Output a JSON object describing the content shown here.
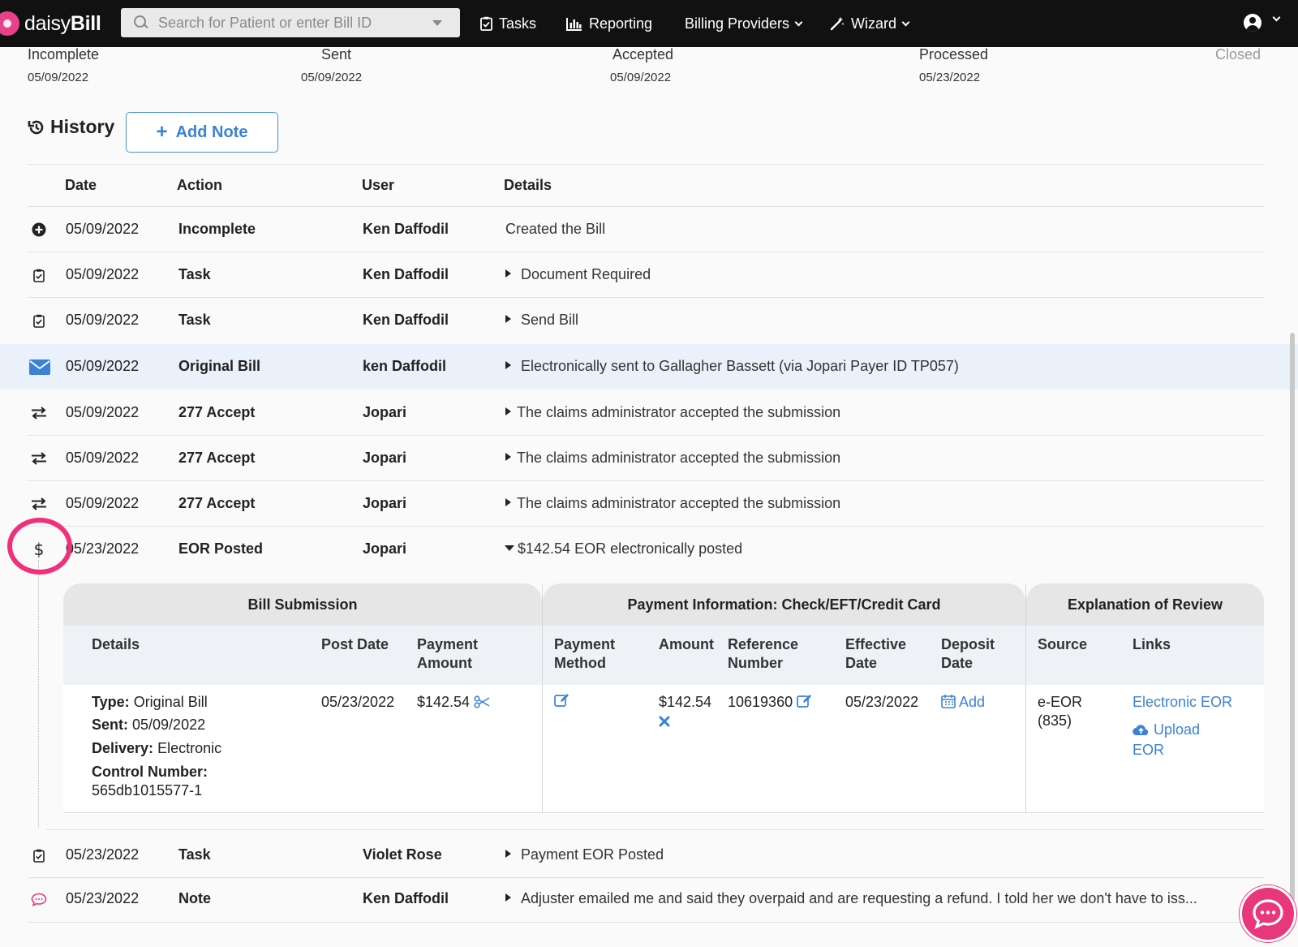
{
  "nav": {
    "logo_light": "daisy",
    "logo_bold": "Bill",
    "search_placeholder": "Search for Patient or enter Bill ID",
    "tasks": "Tasks",
    "reporting": "Reporting",
    "billing_providers": "Billing Providers",
    "wizard": "Wizard"
  },
  "statuses": [
    {
      "label": "Incomplete",
      "date": "05/09/2022"
    },
    {
      "label": "Sent",
      "date": "05/09/2022"
    },
    {
      "label": "Accepted",
      "date": "05/09/2022"
    },
    {
      "label": "Processed",
      "date": "05/23/2022"
    },
    {
      "label": "Closed",
      "date": ""
    }
  ],
  "history": {
    "title": "History",
    "add_note": "Add Note",
    "headers": {
      "date": "Date",
      "action": "Action",
      "user": "User",
      "details": "Details"
    },
    "rows": [
      {
        "icon": "plus-circle-icon",
        "date": "05/09/2022",
        "action": "Incomplete",
        "user": "Ken Daffodil",
        "details": "Created the Bill"
      },
      {
        "icon": "clipboard-check-icon",
        "date": "05/09/2022",
        "action": "Task",
        "user": "Ken Daffodil",
        "details": "Document Required"
      },
      {
        "icon": "clipboard-check-icon",
        "date": "05/09/2022",
        "action": "Task",
        "user": "Ken Daffodil",
        "details": "Send Bill"
      },
      {
        "icon": "envelope-icon",
        "date": "05/09/2022",
        "action": "Original Bill",
        "user": "ken Daffodil",
        "details": "Electronically sent to Gallagher Bassett (via Jopari Payer ID TP057)"
      },
      {
        "icon": "exchange-icon",
        "date": "05/09/2022",
        "action": "277 Accept",
        "user": "Jopari",
        "details": "The claims administrator accepted the submission"
      },
      {
        "icon": "exchange-icon",
        "date": "05/09/2022",
        "action": "277 Accept",
        "user": "Jopari",
        "details": "The claims administrator accepted the submission"
      },
      {
        "icon": "exchange-icon",
        "date": "05/09/2022",
        "action": "277 Accept",
        "user": "Jopari",
        "details": "The claims administrator accepted the submission"
      },
      {
        "icon": "dollar-icon",
        "date": "05/23/2022",
        "action": "EOR Posted",
        "user": "Jopari",
        "details": "$142.54 EOR electronically posted"
      },
      {
        "icon": "clipboard-check-icon",
        "date": "05/23/2022",
        "action": "Task",
        "user": "Violet Rose",
        "details": "Payment EOR Posted"
      },
      {
        "icon": "comment-icon",
        "date": "05/23/2022",
        "action": "Note",
        "user": "Ken Daffodil",
        "details": "Adjuster emailed me and said they overpaid and are requesting a refund. I told her we don't have to iss..."
      }
    ]
  },
  "eor": {
    "groups": {
      "bill_submission": "Bill Submission",
      "payment_info": "Payment Information: Check/EFT/Credit Card",
      "explanation": "Explanation of Review"
    },
    "subheaders": {
      "details": "Details",
      "post_date": "Post Date",
      "payment_amount_1": "Payment",
      "payment_amount_2": "Amount",
      "payment_method_1": "Payment",
      "payment_method_2": "Method",
      "amount": "Amount",
      "reference_number_1": "Reference",
      "reference_number_2": "Number",
      "effective_date_1": "Effective",
      "effective_date_2": "Date",
      "deposit_date_1": "Deposit",
      "deposit_date_2": "Date",
      "source": "Source",
      "links": "Links"
    },
    "body": {
      "type_label": "Type:",
      "type_value": "Original Bill",
      "sent_label": "Sent:",
      "sent_value": "05/09/2022",
      "delivery_label": "Delivery:",
      "delivery_value": "Electronic",
      "control_label": "Control Number:",
      "control_value": "565db1015577-1",
      "post_date": "05/23/2022",
      "payment_amount": "$142.54",
      "amount": "$142.54",
      "reference_number": "10619360",
      "effective_date": "05/23/2022",
      "deposit_add": "Add",
      "source_1": "e-EOR",
      "source_2": "(835)",
      "link_electronic": "Electronic EOR",
      "link_upload_1": "Upload",
      "link_upload_2": "EOR"
    }
  },
  "colors": {
    "accent": "#3b82d6",
    "brand": "#e8377a",
    "highlight_row": "#eaf1fb"
  }
}
